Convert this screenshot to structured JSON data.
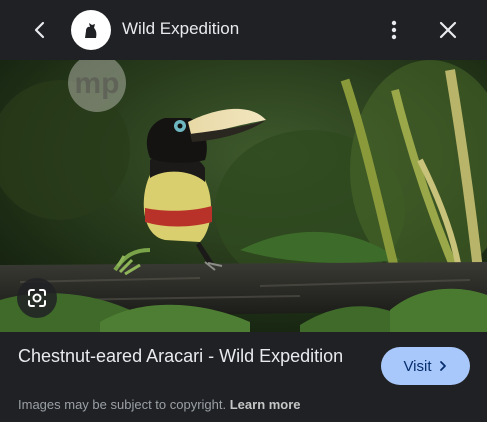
{
  "header": {
    "back_icon": "arrow-back-icon",
    "site_icon": "wild-expedition-logo-icon",
    "site_title": "Wild Expedition",
    "more_icon": "more-vert-icon",
    "close_icon": "close-icon"
  },
  "image": {
    "watermark": "mp",
    "lens_icon": "google-lens-icon"
  },
  "caption": {
    "title": "Chestnut-eared Aracari - Wild Expedition",
    "visit_label": "Visit",
    "visit_icon": "chevron-right-icon",
    "copyright_text": "Images may be subject to copyright.",
    "learn_more": "Learn more"
  },
  "colors": {
    "background": "#202124",
    "visit_button": "#a8c7fa",
    "visit_text": "#062e6f"
  }
}
